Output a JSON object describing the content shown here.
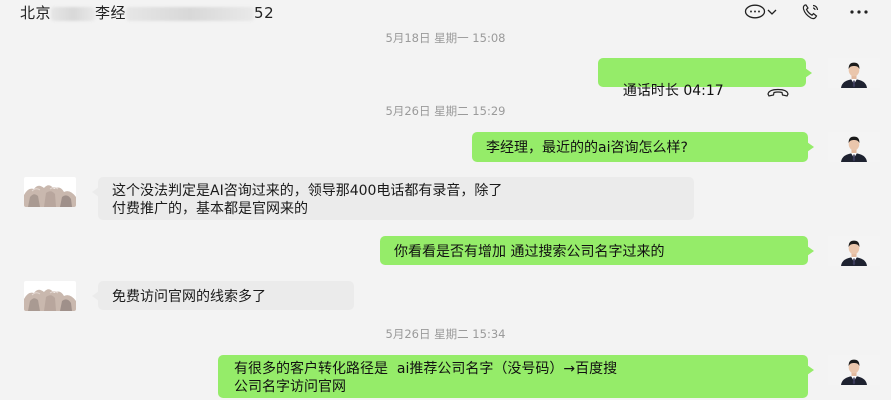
{
  "header": {
    "title_part1": "北京",
    "title_part2": "李经",
    "title_part3": "52",
    "icons": [
      "chat-bubble-icon",
      "chevron-down-icon",
      "phone-call-icon",
      "more-icon"
    ]
  },
  "messages": {
    "ts1": "5月18日 星期一 15:08",
    "call_label": "通话时长 04:17",
    "ts2": "5月26日 星期二 15:29",
    "m1": "李经理，最近的的ai咨询怎么样?",
    "m2": "这个没法判定是AI咨询过来的，领导那400电话都有录音，除了\n付费推广的，基本都是官网来的",
    "m3": "你看看是否有增加 通过搜索公司名字过来的",
    "m4": "免费访问官网的线索多了",
    "ts3": "5月26日 星期二 15:34",
    "m5": "有很多的客户转化路径是  ai推荐公司名字（没号码）→百度搜\n公司名字访问官网"
  },
  "colors": {
    "outgoing_bubble": "#95ec69",
    "incoming_bubble": "#ebebeb",
    "background": "#f3f3f3",
    "timestamp": "#9a9a9a"
  }
}
